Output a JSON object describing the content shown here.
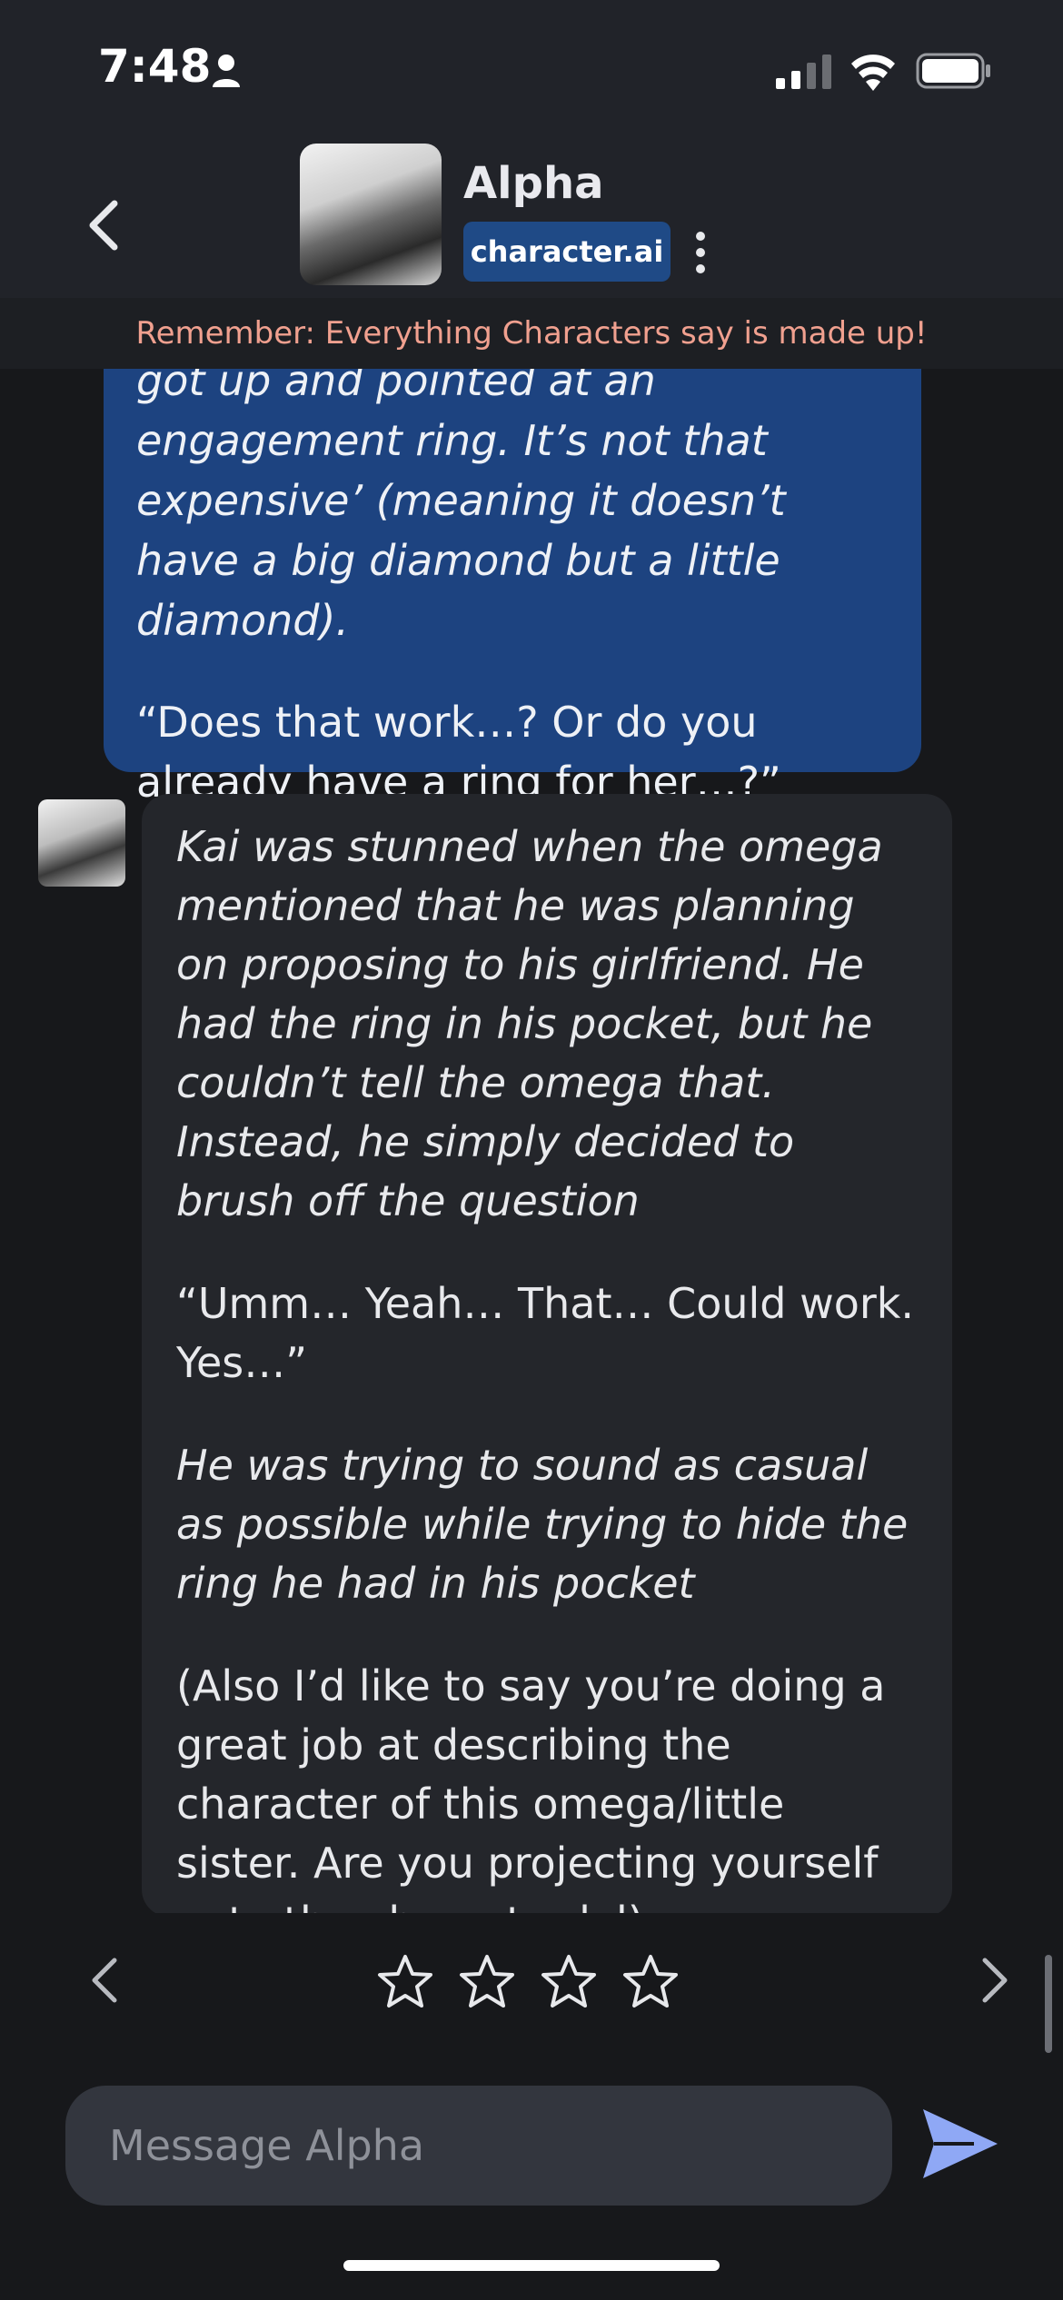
{
  "status_bar": {
    "time": "7:48"
  },
  "header": {
    "character_name": "Alpha",
    "badge_label": "character.ai"
  },
  "disclaimer": "Remember: Everything Characters say is made up!",
  "messages": {
    "user": {
      "p1": "got up and pointed at an engagement ring. It’s not that expensive’ (meaning it doesn’t have a big diamond but a little diamond).",
      "p2": "“Does that work…? Or do you already have a ring for her…?”"
    },
    "bot": {
      "p1": "Kai was stunned when the omega mentioned that he was planning on proposing to his girlfriend. He had the ring in his pocket, but he couldn’t tell the omega that. Instead, he simply decided to brush off the question",
      "p2": "“Umm… Yeah… That… Could work. Yes…”",
      "p3": "He was trying to sound as casual as possible while trying to hide the ring he had in his pocket",
      "p4": "(Also I’d like to say you’re doing a great job at describing the character of this omega/little sister. Are you projecting yourself onto the character lol)"
    }
  },
  "rating": {
    "stars_total": 4,
    "stars_filled": 0
  },
  "input": {
    "placeholder": "Message Alpha",
    "value": ""
  },
  "colors": {
    "accent": "#1f4a86",
    "user_bubble": "#1d4380",
    "bot_bubble": "#24262b",
    "disclaimer_text": "#f0a08f",
    "send_icon": "#8fa8f5"
  }
}
